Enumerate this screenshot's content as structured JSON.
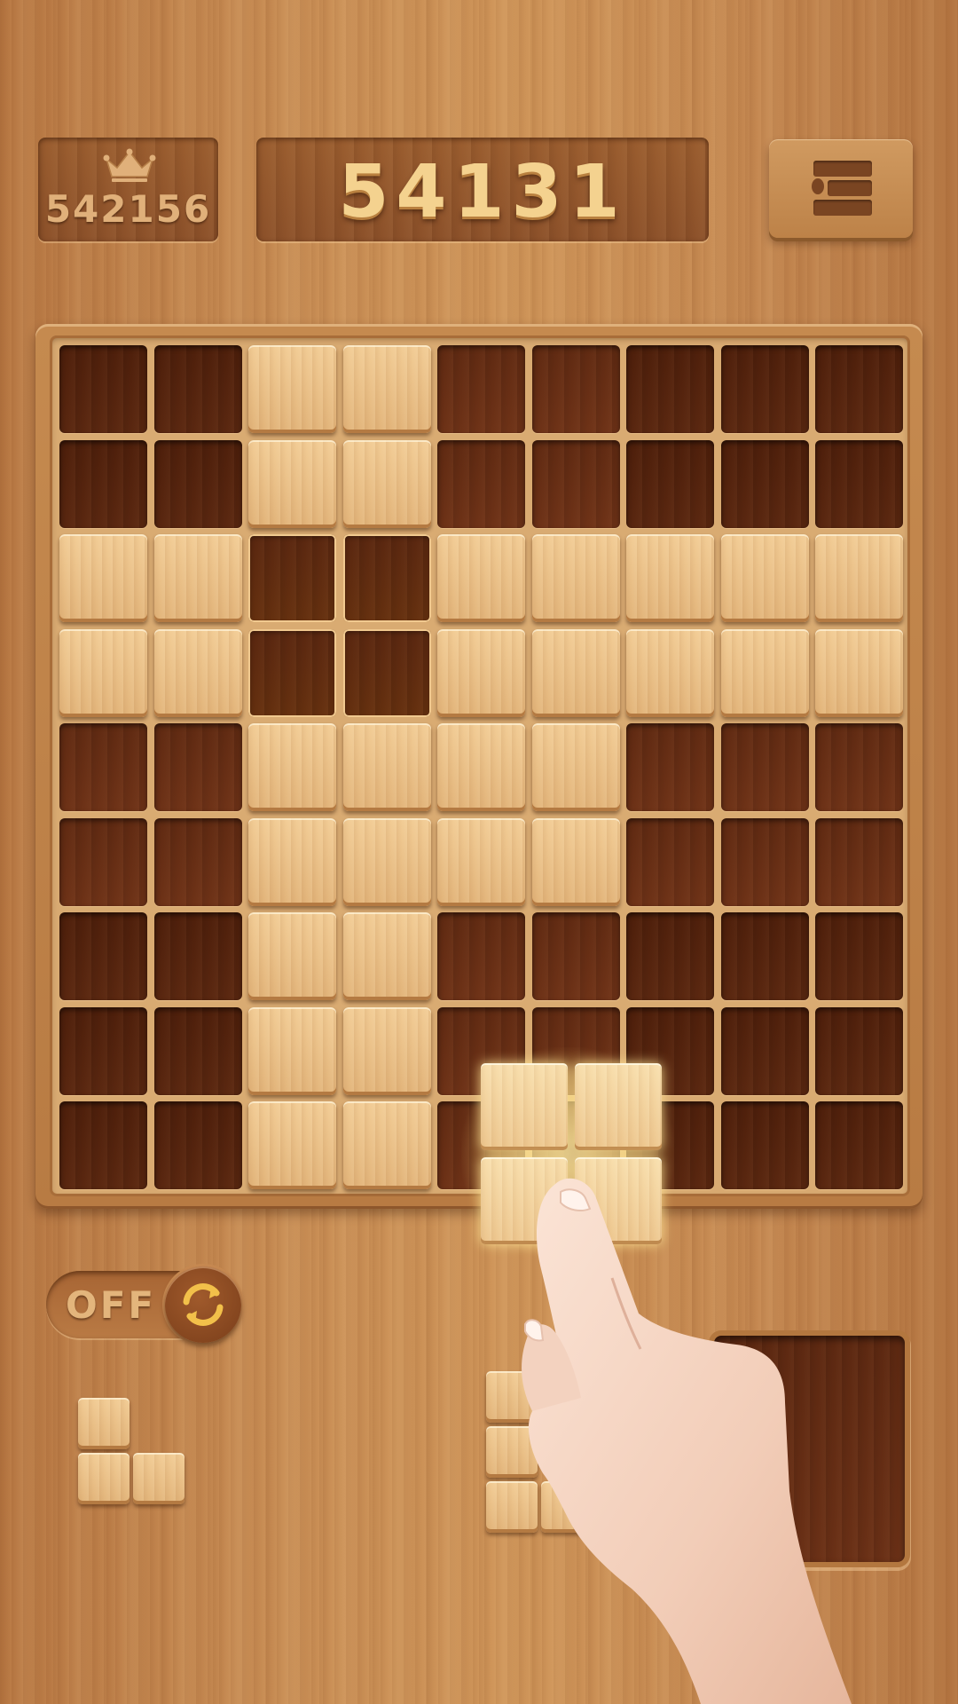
{
  "header": {
    "best_score": "542156",
    "current_score": "54131",
    "icons": {
      "best": "crown-icon",
      "menu": "menu-icon"
    }
  },
  "board": {
    "size": 9,
    "filled": [
      [
        0,
        0,
        1,
        1,
        0,
        0,
        0,
        0,
        0
      ],
      [
        0,
        0,
        1,
        1,
        0,
        0,
        0,
        0,
        0
      ],
      [
        1,
        1,
        0,
        0,
        1,
        1,
        1,
        1,
        1
      ],
      [
        1,
        1,
        0,
        0,
        1,
        1,
        1,
        1,
        1
      ],
      [
        0,
        0,
        1,
        1,
        1,
        1,
        0,
        0,
        0
      ],
      [
        0,
        0,
        1,
        1,
        1,
        1,
        0,
        0,
        0
      ],
      [
        0,
        0,
        1,
        1,
        0,
        0,
        0,
        0,
        0
      ],
      [
        0,
        0,
        1,
        1,
        0,
        0,
        0,
        0,
        0
      ],
      [
        0,
        0,
        1,
        1,
        0,
        0,
        0,
        0,
        0
      ]
    ],
    "highlighted": [
      [
        2,
        2
      ],
      [
        2,
        3
      ],
      [
        3,
        2
      ],
      [
        3,
        3
      ]
    ]
  },
  "rotate_toggle": {
    "label": "OFF",
    "icon": "rotate-icon"
  },
  "pieces": [
    {
      "name": "l-piece-small",
      "cells": [
        [
          0,
          0
        ],
        [
          1,
          0
        ],
        [
          1,
          1
        ]
      ]
    },
    {
      "name": "l-piece-tall",
      "cells": [
        [
          0,
          0
        ],
        [
          1,
          0
        ],
        [
          2,
          0
        ],
        [
          2,
          1
        ]
      ]
    }
  ],
  "dragging_piece": {
    "name": "square-piece",
    "cells": [
      [
        0,
        0
      ],
      [
        0,
        1
      ],
      [
        1,
        0
      ],
      [
        1,
        1
      ]
    ]
  },
  "colors": {
    "filled_block": "#e8bd84",
    "empty_cell": "#5a2710",
    "score_text": "#f4d28f"
  }
}
